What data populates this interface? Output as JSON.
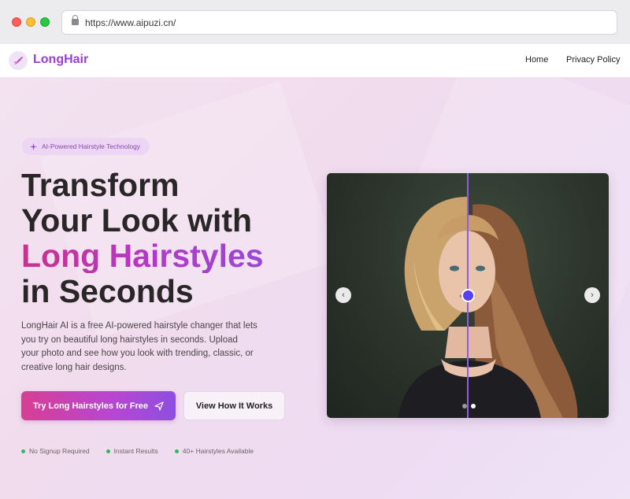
{
  "browser": {
    "url": "https://www.aipuzi.cn/"
  },
  "nav": {
    "brand": "LongHair",
    "links": [
      "Home",
      "Privacy Policy"
    ]
  },
  "hero": {
    "badge": "AI-Powered Hairstyle Technology",
    "headline_line1": "Transform",
    "headline_line2": "Your Look with",
    "headline_highlight": "Long Hairstyles",
    "headline_line4": "in Seconds",
    "description": "LongHair AI is a free AI-powered hairstyle changer that lets you try on beautiful long hairstyles in seconds. Upload your photo and see how you look with trending, classic, or creative long hair designs.",
    "primary_button": "Try Long Hairstyles for Free",
    "secondary_button": "View How It Works",
    "features": [
      "No Signup Required",
      "Instant Results",
      "40+ Hairstyles Available"
    ]
  },
  "carousel": {
    "slide_count": 2,
    "active_slide": 2
  },
  "colors": {
    "brand": "#9b3fd2",
    "accent_gradient_start": "#d73f93",
    "accent_gradient_end": "#8e4fe0",
    "feature_dot": "#2fba5a"
  },
  "icons": {
    "badge": "sparkles-icon",
    "logo": "brush-icon",
    "primary_button": "send-icon"
  }
}
